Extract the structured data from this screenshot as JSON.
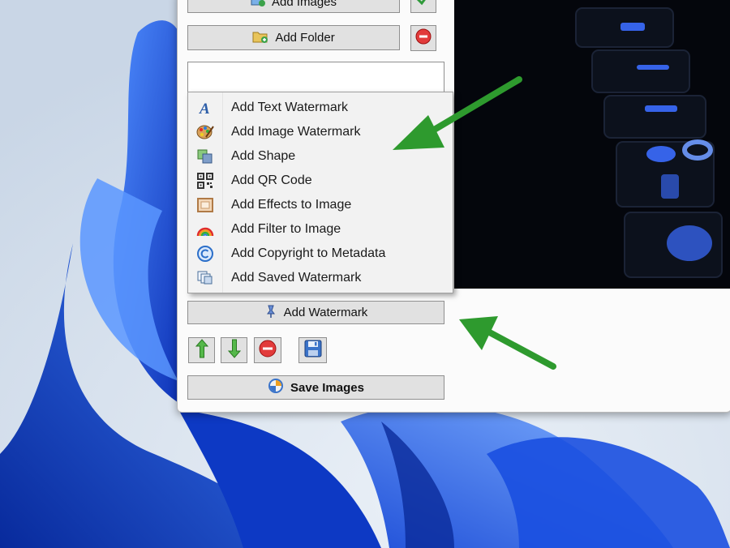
{
  "top_panel": {
    "add_images_label": "Add Images",
    "add_folder_label": "Add Folder"
  },
  "watermark_menu": {
    "items": [
      {
        "label": "Add Text Watermark",
        "icon": "text-a-icon"
      },
      {
        "label": "Add Image Watermark",
        "icon": "palette-icon"
      },
      {
        "label": "Add Shape",
        "icon": "shape-icon"
      },
      {
        "label": "Add QR Code",
        "icon": "qr-code-icon"
      },
      {
        "label": "Add Effects to Image",
        "icon": "frame-icon"
      },
      {
        "label": "Add Filter to Image",
        "icon": "rainbow-icon"
      },
      {
        "label": "Add Copyright to Metadata",
        "icon": "copyright-icon"
      },
      {
        "label": "Add Saved Watermark",
        "icon": "saved-stack-icon"
      }
    ]
  },
  "actions": {
    "add_watermark_label": "Add Watermark",
    "save_images_label": "Save Images"
  },
  "colors": {
    "arrow_green": "#2e9a2e",
    "desktop_blue": "#1f5fe0",
    "button_face": "#e1e1e1"
  }
}
